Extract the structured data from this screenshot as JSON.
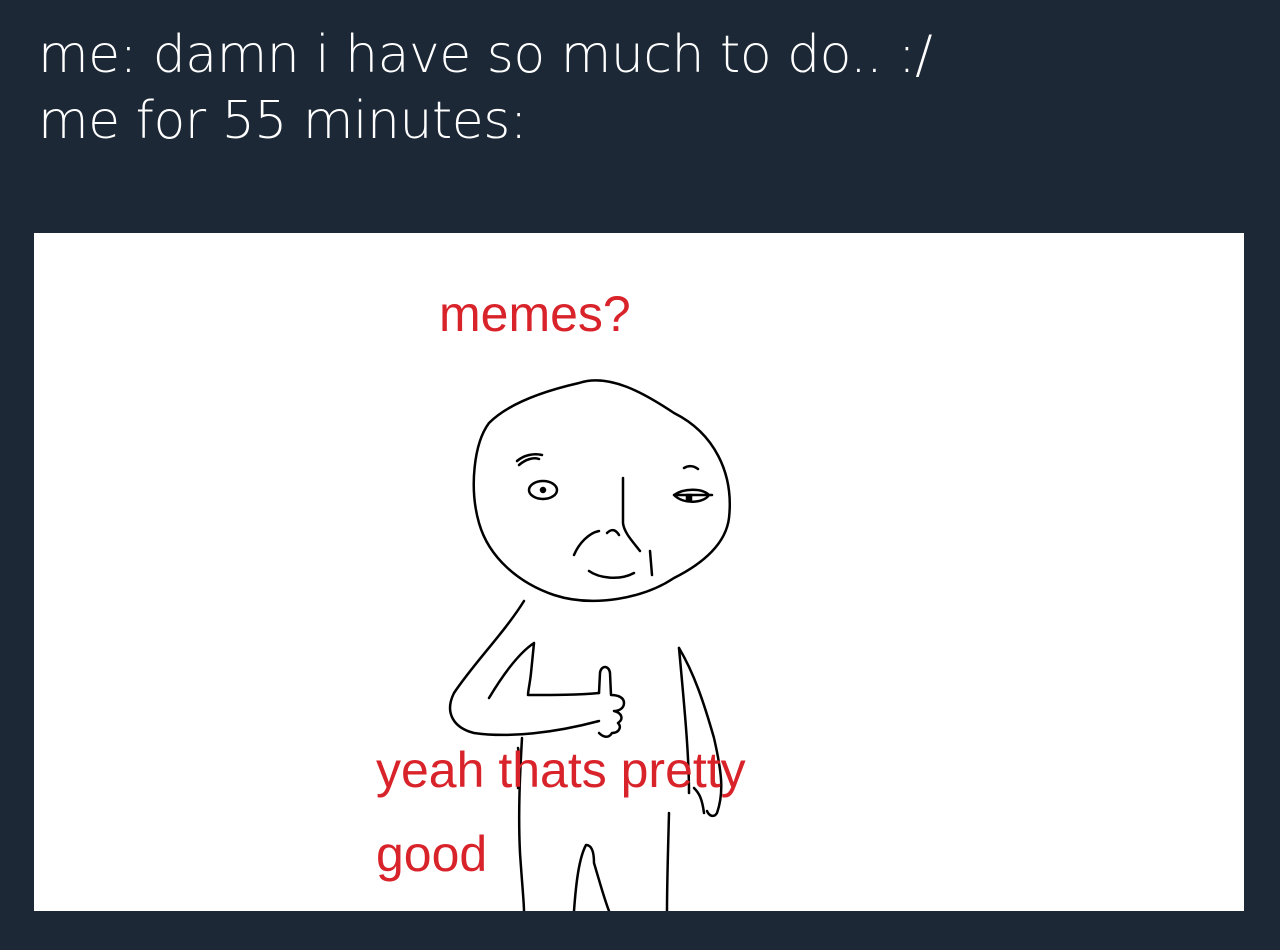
{
  "tweet": {
    "caption_line1": "me: damn i have so much to do.. :/",
    "caption_line2": "me for 55 minutes:"
  },
  "meme": {
    "top_text": "memes?",
    "bottom_text_line1": "yeah thats pretty",
    "bottom_text_line2": "good"
  },
  "colors": {
    "background": "#1c2836",
    "caption_text": "#ffffff",
    "meme_background": "#ffffff",
    "meme_text": "#d9232a",
    "drawing_stroke": "#000000"
  }
}
